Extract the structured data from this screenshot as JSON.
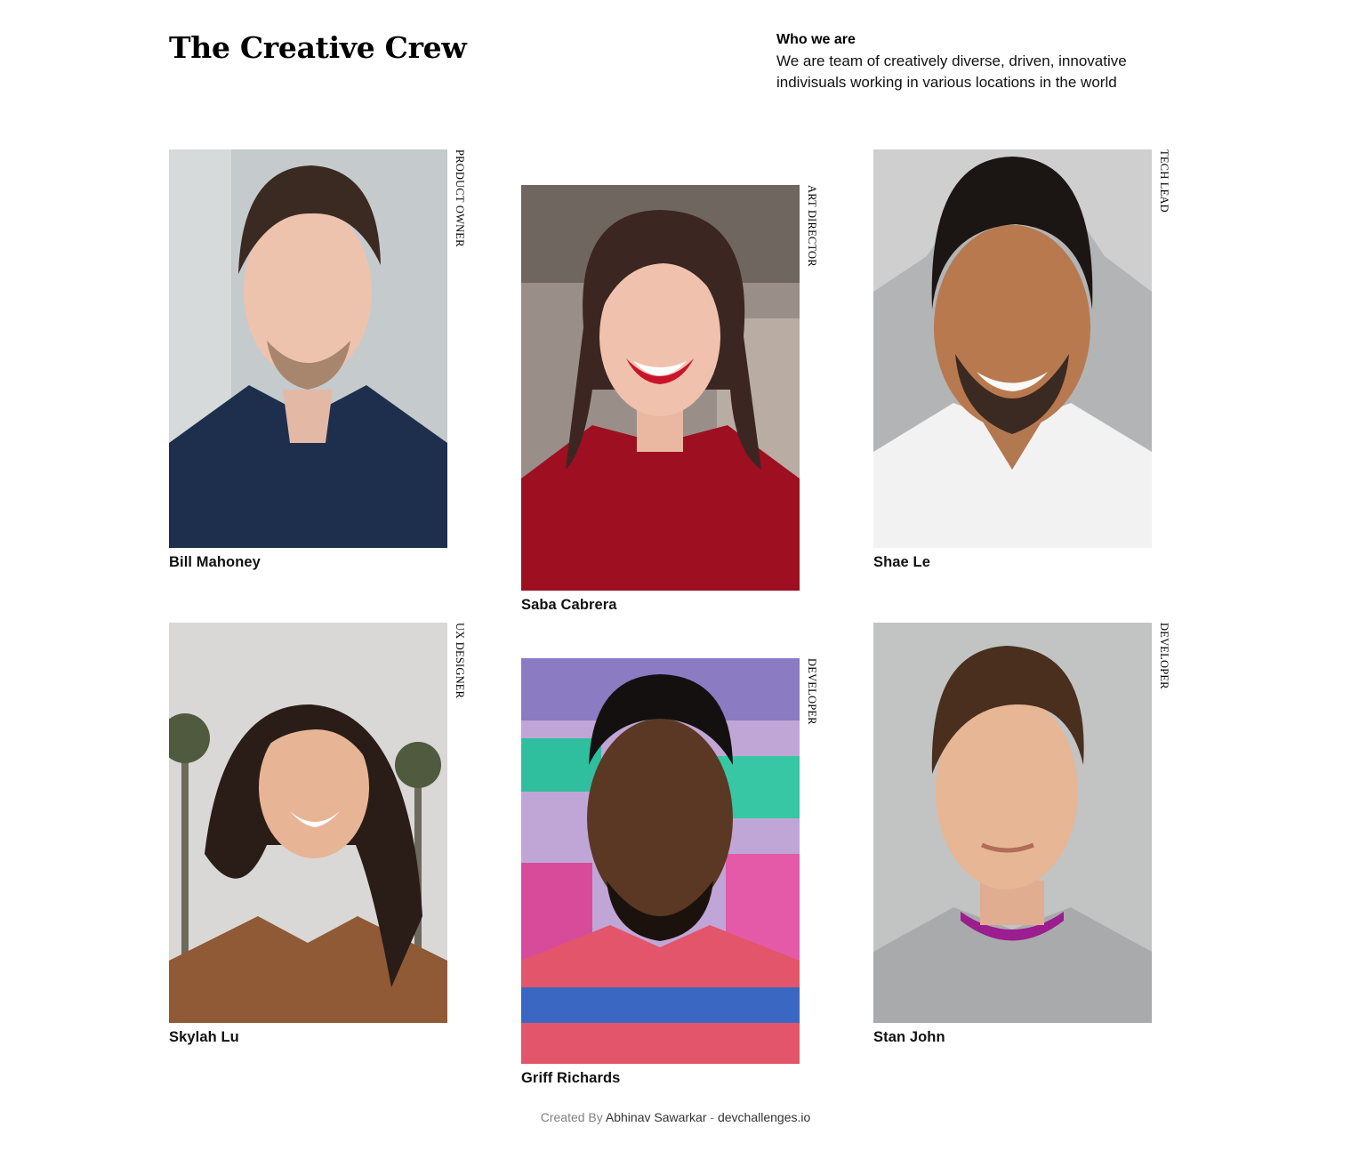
{
  "header": {
    "title": "The Creative Crew",
    "intro_heading": "Who we are",
    "intro_text": "We are team of creatively diverse, driven, innovative indivisuals working in various locations in the world"
  },
  "members": [
    {
      "name": "Bill Mahoney",
      "role": "PRODUCT OWNER",
      "photo": "portrait-photo"
    },
    {
      "name": "Saba Cabrera",
      "role": "ART DIRECTOR",
      "photo": "portrait-photo"
    },
    {
      "name": "Shae Le",
      "role": "TECH LEAD",
      "photo": "portrait-photo"
    },
    {
      "name": "Skylah Lu",
      "role": "UX DESIGNER",
      "photo": "portrait-photo"
    },
    {
      "name": "Griff Richards",
      "role": "DEVELOPER",
      "photo": "portrait-photo"
    },
    {
      "name": "Stan John",
      "role": "DEVELOPER",
      "photo": "portrait-photo"
    }
  ],
  "footer": {
    "created_by": "Created By",
    "author": "Abhinav Sawarkar",
    "separator": "-",
    "site": "devchallenges.io"
  },
  "colors": {
    "background": "#ffffff",
    "text": "#000000",
    "muted": "#828282"
  }
}
